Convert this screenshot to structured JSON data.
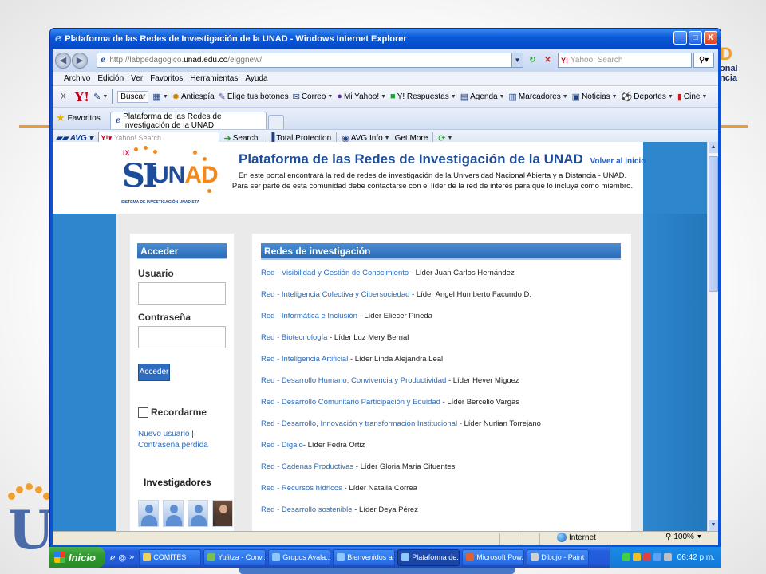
{
  "window": {
    "title": "Plataforma de las Redes de Investigación de la UNAD - Windows Internet Explorer",
    "controls": [
      "_",
      "□",
      "X"
    ]
  },
  "address_bar": {
    "prefix": "http://labpedagogico.",
    "domain": "unad.edu.co",
    "suffix": "/elggnew/",
    "search_placeholder": "Yahoo! Search"
  },
  "menu": [
    "Archivo",
    "Edición",
    "Ver",
    "Favoritos",
    "Herramientas",
    "Ayuda"
  ],
  "yahoo_toolbar": {
    "buscar": "Buscar",
    "items": [
      "Antiespía",
      "Elige tus botones",
      "Correo",
      "Mi Yahoo!",
      "Y! Respuestas",
      "Agenda",
      "Marcadores",
      "Noticias",
      "Deportes",
      "Cine"
    ]
  },
  "favorites": {
    "label": "Favoritos",
    "tab_title": "Plataforma de las Redes de Investigación de la UNAD"
  },
  "avg_toolbar": {
    "logo": "AVG",
    "search_placeholder": "Yahoo! Search",
    "search_btn": "Search",
    "total_protection": "Total Protection",
    "avg_info": "AVG Info",
    "get_more": "Get More"
  },
  "header": {
    "logo_ix": "IX",
    "logo_si": "SI",
    "logo_un": "UN",
    "logo_ad": "AD",
    "logo_sub": "SISTEMA DE INVESTIGACIÓN UNADISTA",
    "title": "Plataforma de las Redes de Investigación de la UNAD",
    "volver": "Volver al inicio",
    "description": "En este portal encontrará la red de redes de investigación de la Universidad Nacional Abierta y a Distancia - UNAD. Para ser parte de esta comunidad debe contactarse con el líder de la red de interés para que lo incluya como miembro."
  },
  "login": {
    "heading": "Acceder",
    "user_label": "Usuario",
    "pass_label": "Contraseña",
    "button": "Acceder",
    "remember": "Recordarme",
    "new_user": "Nuevo usuario",
    "separator": "|",
    "lost_password": "Contraseña perdida",
    "researchers": "Investigadores"
  },
  "redes": {
    "heading": "Redes de investigación",
    "items": [
      {
        "link": "Red - Visibilidad y Gestión de Conocimiento",
        "leader": " - Líder Juan Carlos Hernández"
      },
      {
        "link": "Red - Inteligencia Colectiva y Cibersociedad",
        "leader": " - Líder Angel Humberto Facundo D."
      },
      {
        "link": "Red - Informática e Inclusión",
        "leader": " - Líder Eliecer Pineda"
      },
      {
        "link": "Red - Biotecnología",
        "leader": " - Líder Luz Mery Bernal"
      },
      {
        "link": "Red - Inteligencia Artificial",
        "leader": " - Líder Linda Alejandra Leal"
      },
      {
        "link": "Red - Desarrollo Humano, Convivencia y Productividad",
        "leader": " - Líder Hever Miguez"
      },
      {
        "link": "Red - Desarrollo Comunitario Participación y Equidad",
        "leader": " - Líder Bercelio Vargas"
      },
      {
        "link": "Red - Desarrollo, Innovación y transformación Institucional",
        "leader": " - Líder Nurlian Torrejano"
      },
      {
        "link": "Red - Digalo",
        "leader": "- Líder Fedra Ortiz"
      },
      {
        "link": "Red - Cadenas Productivas",
        "leader": " - Líder Gloria Maria Cifuentes"
      },
      {
        "link": "Red - Recursos hídricos",
        "leader": " - Líder Natalia Correa"
      },
      {
        "link": "Red - Desarrollo sostenible",
        "leader": " - Líder Deya Pérez"
      }
    ]
  },
  "status": {
    "zone": "Internet",
    "zoom": "100%"
  },
  "taskbar": {
    "start": "Inicio",
    "buttons": [
      "COMITES",
      "Yulitza - Conv...",
      "Grupos Avala...",
      "Bienvenidos a ...",
      "Plataforma de...",
      "Microsoft Pow...",
      "Dibujo - Paint"
    ],
    "clock": "06:42 p.m."
  },
  "slide": {
    "brand_top": "D",
    "brand_line1": "onal",
    "brand_line2": "ncia",
    "u_letter": "U"
  }
}
